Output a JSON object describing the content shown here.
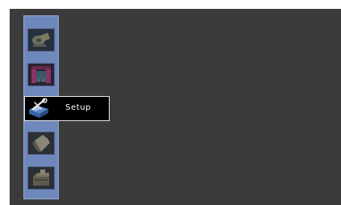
{
  "menu": {
    "items": [
      {
        "icon": "film-reel-icon"
      },
      {
        "icon": "theater-stage-icon"
      },
      {
        "icon": "setup-toolbox-icon",
        "label": "Setup",
        "selected": true
      },
      {
        "icon": "disc-tray-icon"
      },
      {
        "icon": "storage-box-icon"
      }
    ]
  },
  "colors": {
    "background": "#3b3b3b",
    "panel": "#6f88bb",
    "selected_bg": "#000000",
    "selected_border": "#e8e8e8",
    "label": "#ffffff"
  }
}
